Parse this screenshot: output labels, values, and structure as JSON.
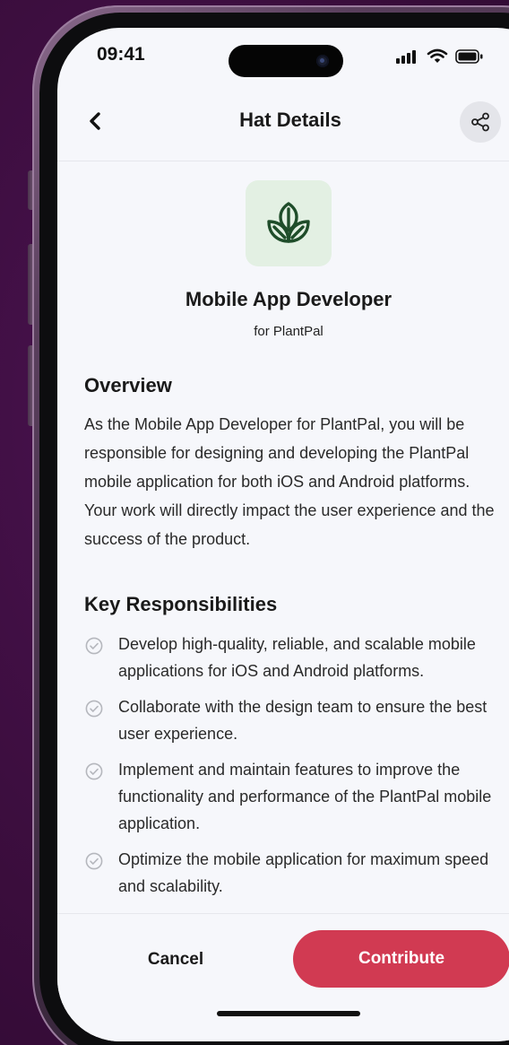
{
  "status_bar": {
    "time": "09:41"
  },
  "header": {
    "title": "Hat Details",
    "back_icon": "chevron-left-icon",
    "share_icon": "share-icon"
  },
  "hat": {
    "title": "Mobile App Developer",
    "subtitle": "for PlantPal",
    "logo_icon": "leaves-icon"
  },
  "overview": {
    "heading": "Overview",
    "body": "As the Mobile App Developer for PlantPal, you will be responsible for designing and developing the PlantPal mobile application for both iOS and Android platforms. Your work will directly impact the user experience and the success of the product."
  },
  "responsibilities": {
    "heading": "Key Responsibilities",
    "items": [
      "Develop high-quality, reliable, and scalable mobile applications for iOS and Android platforms.",
      "Collaborate with the design team to ensure the best user experience.",
      "Implement and maintain features to improve the functionality and performance of the PlantPal mobile application.",
      "Optimize the mobile application for maximum speed and scalability."
    ]
  },
  "actions": {
    "cancel_label": "Cancel",
    "contribute_label": "Contribute"
  },
  "colors": {
    "accent": "#d13a52",
    "logo_bg": "#e3f0e3",
    "logo_fg": "#1f4d2a",
    "background": "#3a0d3c"
  }
}
